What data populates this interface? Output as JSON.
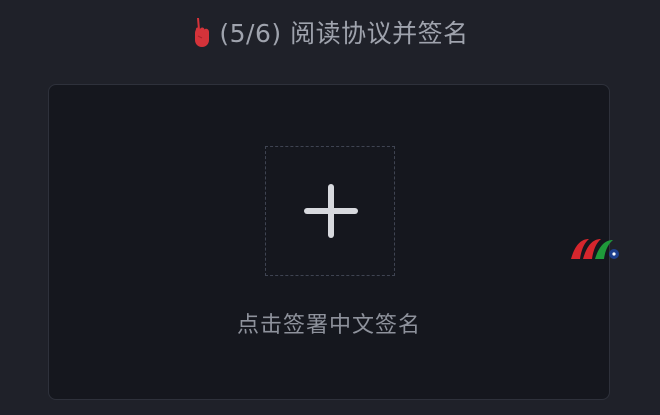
{
  "header": {
    "icon": "pointing-hand-icon",
    "step": "(5/6)",
    "title": "阅读协议并签名"
  },
  "signature": {
    "add_icon": "plus-icon",
    "hint": "点击签署中文签名"
  },
  "watermark": {
    "icon": "brand-logo-icon"
  },
  "colors": {
    "background": "#1f2129",
    "card": "#15171e",
    "text": "#9fa3ad",
    "hand": "#d4333a",
    "logo_red": "#d6262d",
    "logo_green": "#1f9a3a",
    "logo_blue": "#1d3f8c"
  }
}
